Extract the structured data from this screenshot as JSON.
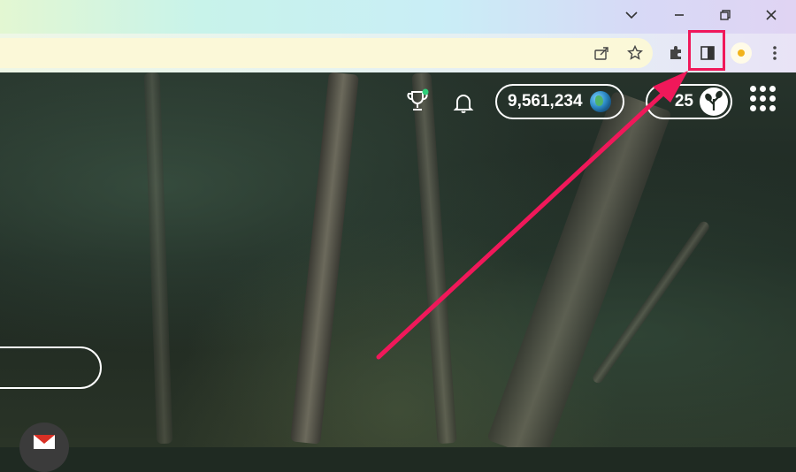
{
  "browser": {
    "window_controls": {
      "tab_search": "⌄",
      "minimize": "–",
      "restore": "❐",
      "close": "✕"
    },
    "toolbar": {
      "share_icon": "share-icon",
      "bookmark_icon": "star-icon",
      "extensions_icon": "puzzle-icon",
      "side_panel_icon": "side-panel-icon",
      "profile_icon": "avatar",
      "menu_icon": "⋮"
    },
    "highlight_color": "#f0185a"
  },
  "page": {
    "counter_value": "9,561,234",
    "tree_count": "25",
    "accent": "#f0185a"
  }
}
